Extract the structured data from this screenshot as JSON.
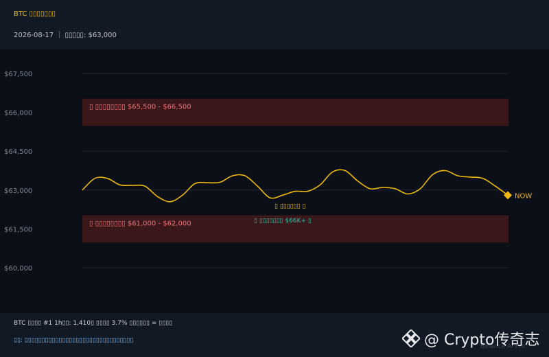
{
  "header": {
    "title": "BTC ▯▯▯▯▯▯▯",
    "subtitle": "2026-08-17 ｜ ▯▯▯▯▯: $63,000"
  },
  "chart_data": {
    "type": "line",
    "ylim": [
      59200,
      68600
    ],
    "y_ticks": [
      {
        "value": 60000,
        "label": "$60,000"
      },
      {
        "value": 61500,
        "label": "$61,500"
      },
      {
        "value": 63000,
        "label": "$63,000"
      },
      {
        "value": 64500,
        "label": "$64,500"
      },
      {
        "value": 66000,
        "label": "$66,000"
      },
      {
        "value": 67500,
        "label": "$67,500"
      }
    ],
    "zones": [
      {
        "label": "▯ ▯▯▯▯▯▯▯▯  $65,500 - $66,500",
        "low": 65500,
        "high": 66500
      },
      {
        "label": "▯ ▯▯▯▯▯▯▯▯  $61,000 - $62,000",
        "low": 61000,
        "high": 62000
      }
    ],
    "series": [
      {
        "values": [
          63000,
          63450,
          63450,
          63200,
          63180,
          63150,
          62750,
          62550,
          62800,
          63250,
          63280,
          63300,
          63550,
          63550,
          63150,
          62700,
          62800,
          62950,
          62950,
          63200,
          63700,
          63750,
          63350,
          63050,
          63100,
          63050,
          62850,
          63050,
          63600,
          63750,
          63550,
          63500,
          63450,
          63150,
          62800
        ],
        "color": "#f0b90b"
      }
    ],
    "now_label": "NOW",
    "annotation_1": "▯ ▯▯▯▯▯▯ ▯",
    "annotation_2": "▯ ▯▯▯▯▯▯▯ $66K+ ▯"
  },
  "footer": {
    "line1": "BTC  ▯▯▯▯ #1  1h▯▯: 1,410▯  ▯▯▯▯ 3.7%  ▯▯▯▯▯▯ = ▯▯▯▯",
    "line2": "▯▯: ▯▯▯▯▯▯▯▯▯▯▯▯▯▯▯▯▯▯▯▯▯▯▯▯▯▯▯▯▯▯▯▯"
  },
  "brand": {
    "watermark": "@ Crypto传奇志",
    "sub": "Binance AI Pro"
  }
}
